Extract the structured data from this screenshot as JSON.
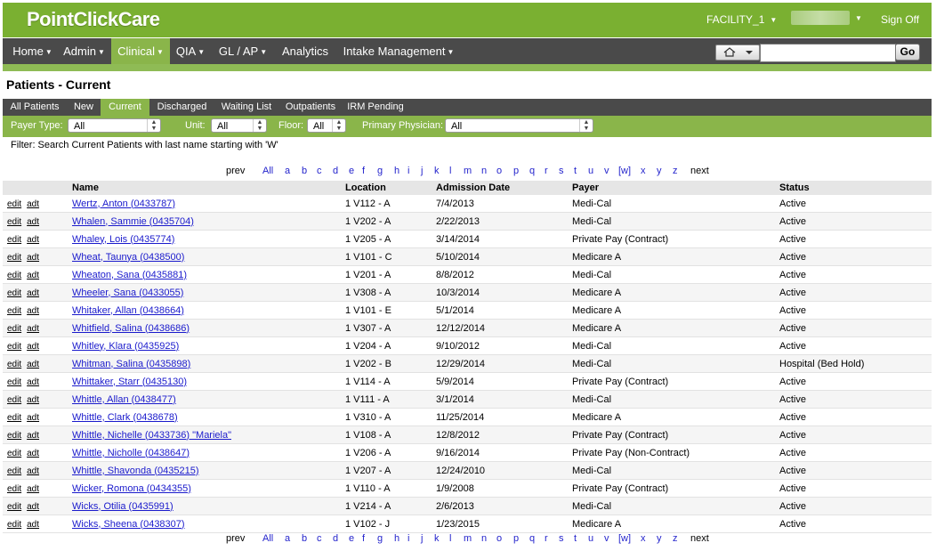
{
  "app": {
    "logo": "PointClickCare",
    "facility": "FACILITY_1",
    "signoff": "Sign Off"
  },
  "nav": {
    "items": [
      {
        "label": "Home",
        "caret": true
      },
      {
        "label": "Admin",
        "caret": true
      },
      {
        "label": "Clinical",
        "caret": true,
        "active": true
      },
      {
        "label": "QIA",
        "caret": true
      },
      {
        "label": "GL / AP",
        "caret": true
      },
      {
        "label": "Analytics",
        "caret": false
      },
      {
        "label": "Intake Management",
        "caret": true
      }
    ],
    "go_label": "Go",
    "search_value": ""
  },
  "page": {
    "title": "Patients - Current"
  },
  "tabs": [
    "All Patients",
    "New",
    "Current",
    "Discharged",
    "Waiting List",
    "Outpatients",
    "IRM Pending"
  ],
  "active_tab": "Current",
  "filters": {
    "payer_type_label": "Payer Type:",
    "payer_type_value": "All",
    "unit_label": "Unit:",
    "unit_value": "All",
    "floor_label": "Floor:",
    "floor_value": "All",
    "physician_label": "Primary Physician:",
    "physician_value": "All"
  },
  "filter_text": "Filter: Search Current Patients with last name starting with 'W'",
  "pager": {
    "prev": "prev",
    "next": "next",
    "all": "All",
    "letters": [
      "a",
      "b",
      "c",
      "d",
      "e",
      "f",
      "g",
      "h",
      "i",
      "j",
      "k",
      "l",
      "m",
      "n",
      "o",
      "p",
      "q",
      "r",
      "s",
      "t",
      "u",
      "v",
      "[w]",
      "x",
      "y",
      "z"
    ]
  },
  "table": {
    "row_actions": [
      "edit",
      "adt"
    ],
    "columns": [
      "",
      "Name",
      "Location",
      "Admission Date",
      "Payer",
      "Status"
    ],
    "rows": [
      {
        "name": "Wertz, Anton (0433787)",
        "location": "1 V112 - A",
        "admission": "7/4/2013",
        "payer": "Medi-Cal",
        "status": "Active"
      },
      {
        "name": "Whalen, Sammie (0435704)",
        "location": "1 V202 - A",
        "admission": "2/22/2013",
        "payer": "Medi-Cal",
        "status": "Active"
      },
      {
        "name": "Whaley, Lois (0435774)",
        "location": "1 V205 - A",
        "admission": "3/14/2014",
        "payer": "Private Pay (Contract)",
        "status": "Active"
      },
      {
        "name": "Wheat, Taunya (0438500)",
        "location": "1 V101 - C",
        "admission": "5/10/2014",
        "payer": "Medicare A",
        "status": "Active"
      },
      {
        "name": "Wheaton, Sana (0435881)",
        "location": "1 V201 - A",
        "admission": "8/8/2012",
        "payer": "Medi-Cal",
        "status": "Active"
      },
      {
        "name": "Wheeler, Sana (0433055)",
        "location": "1 V308 - A",
        "admission": "10/3/2014",
        "payer": "Medicare A",
        "status": "Active"
      },
      {
        "name": "Whitaker, Allan (0438664)",
        "location": "1 V101 - E",
        "admission": "5/1/2014",
        "payer": "Medicare A",
        "status": "Active"
      },
      {
        "name": "Whitfield, Salina (0438686)",
        "location": "1 V307 - A",
        "admission": "12/12/2014",
        "payer": "Medicare A",
        "status": "Active"
      },
      {
        "name": "Whitley, Klara (0435925)",
        "location": "1 V204 - A",
        "admission": "9/10/2012",
        "payer": "Medi-Cal",
        "status": "Active"
      },
      {
        "name": "Whitman, Salina (0435898)",
        "location": "1 V202 - B",
        "admission": "12/29/2014",
        "payer": "Medi-Cal",
        "status": "Hospital (Bed Hold)"
      },
      {
        "name": "Whittaker, Starr (0435130)",
        "location": "1 V114 - A",
        "admission": "5/9/2014",
        "payer": "Private Pay (Contract)",
        "status": "Active"
      },
      {
        "name": "Whittle, Allan (0438477)",
        "location": "1 V111 - A",
        "admission": "3/1/2014",
        "payer": "Medi-Cal",
        "status": "Active"
      },
      {
        "name": "Whittle, Clark (0438678)",
        "location": "1 V310 - A",
        "admission": "11/25/2014",
        "payer": "Medicare A",
        "status": "Active"
      },
      {
        "name": "Whittle, Nichelle (0433736) \"Mariela\"",
        "location": "1 V108 - A",
        "admission": "12/8/2012",
        "payer": "Private Pay (Contract)",
        "status": "Active"
      },
      {
        "name": "Whittle, Nicholle (0438647)",
        "location": "1 V206 - A",
        "admission": "9/16/2014",
        "payer": "Private Pay (Non-Contract)",
        "status": "Active"
      },
      {
        "name": "Whittle, Shavonda (0435215)",
        "location": "1 V207 - A",
        "admission": "12/24/2010",
        "payer": "Medi-Cal",
        "status": "Active"
      },
      {
        "name": "Wicker, Romona (0434355)",
        "location": "1 V110 - A",
        "admission": "1/9/2008",
        "payer": "Private Pay (Contract)",
        "status": "Active"
      },
      {
        "name": "Wicks, Otilia (0435991)",
        "location": "1 V214 - A",
        "admission": "2/6/2013",
        "payer": "Medi-Cal",
        "status": "Active"
      },
      {
        "name": "Wicks, Sheena (0438307)",
        "location": "1 V102 - J",
        "admission": "1/23/2015",
        "payer": "Medicare A",
        "status": "Active"
      }
    ]
  }
}
